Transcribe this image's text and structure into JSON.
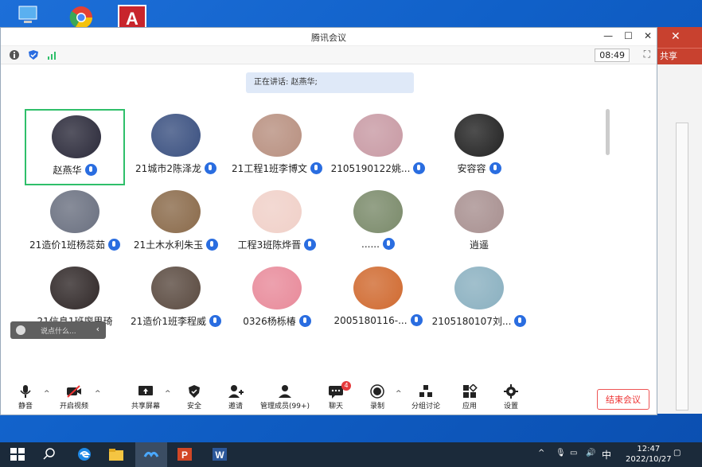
{
  "window": {
    "title": "腾讯会议",
    "clock": "08:49"
  },
  "speaking_label": "正在讲话: 赵燕华;",
  "participants": [
    {
      "name": "赵燕华",
      "mic": "active",
      "color": "#2b2a3a"
    },
    {
      "name": "21城市2陈泽龙",
      "mic": "active",
      "color": "#3a5080"
    },
    {
      "name": "21工程1班李博文",
      "mic": "active",
      "color": "#b89080"
    },
    {
      "name": "2105190122姚...",
      "mic": "active",
      "color": "#c89aa4"
    },
    {
      "name": "安容容",
      "mic": "active",
      "color": "#222222"
    },
    {
      "name": "21造价1班杨蕊茹",
      "mic": "active",
      "color": "#6a7080"
    },
    {
      "name": "21土木水利朱玉",
      "mic": "active",
      "color": "#8a6a4a"
    },
    {
      "name": "工程3班陈烨晋",
      "mic": "active",
      "color": "#f0d0c8"
    },
    {
      "name": "......",
      "mic": "active",
      "color": "#7a8a6a"
    },
    {
      "name": "逍遥",
      "mic": "none",
      "color": "#a89090"
    },
    {
      "name": "21信息1班廖思琦",
      "mic": "none",
      "color": "#302828"
    },
    {
      "name": "21造价1班李程威",
      "mic": "active",
      "color": "#5a4a40"
    },
    {
      "name": "0326杨栎椿",
      "mic": "active",
      "color": "#e88a9a"
    },
    {
      "name": "2005180116-...",
      "mic": "active",
      "color": "#d06a30"
    },
    {
      "name": "2105180107刘...",
      "mic": "active",
      "color": "#8ab0c0"
    }
  ],
  "chat_input": {
    "placeholder": "说点什么..."
  },
  "toolbar": {
    "mute": "静音",
    "video": "开启视频",
    "share": "共享屏幕",
    "security": "安全",
    "invite": "邀请",
    "members": "管理成员(99+)",
    "chat": "聊天",
    "chat_badge": "4",
    "record": "录制",
    "breakout": "分组讨论",
    "apps": "应用",
    "settings": "设置",
    "end": "结束会议"
  },
  "bg_window": {
    "tab": "共享"
  },
  "taskbar": {
    "time": "12:47",
    "date": "2022/10/27",
    "ime": "中"
  }
}
